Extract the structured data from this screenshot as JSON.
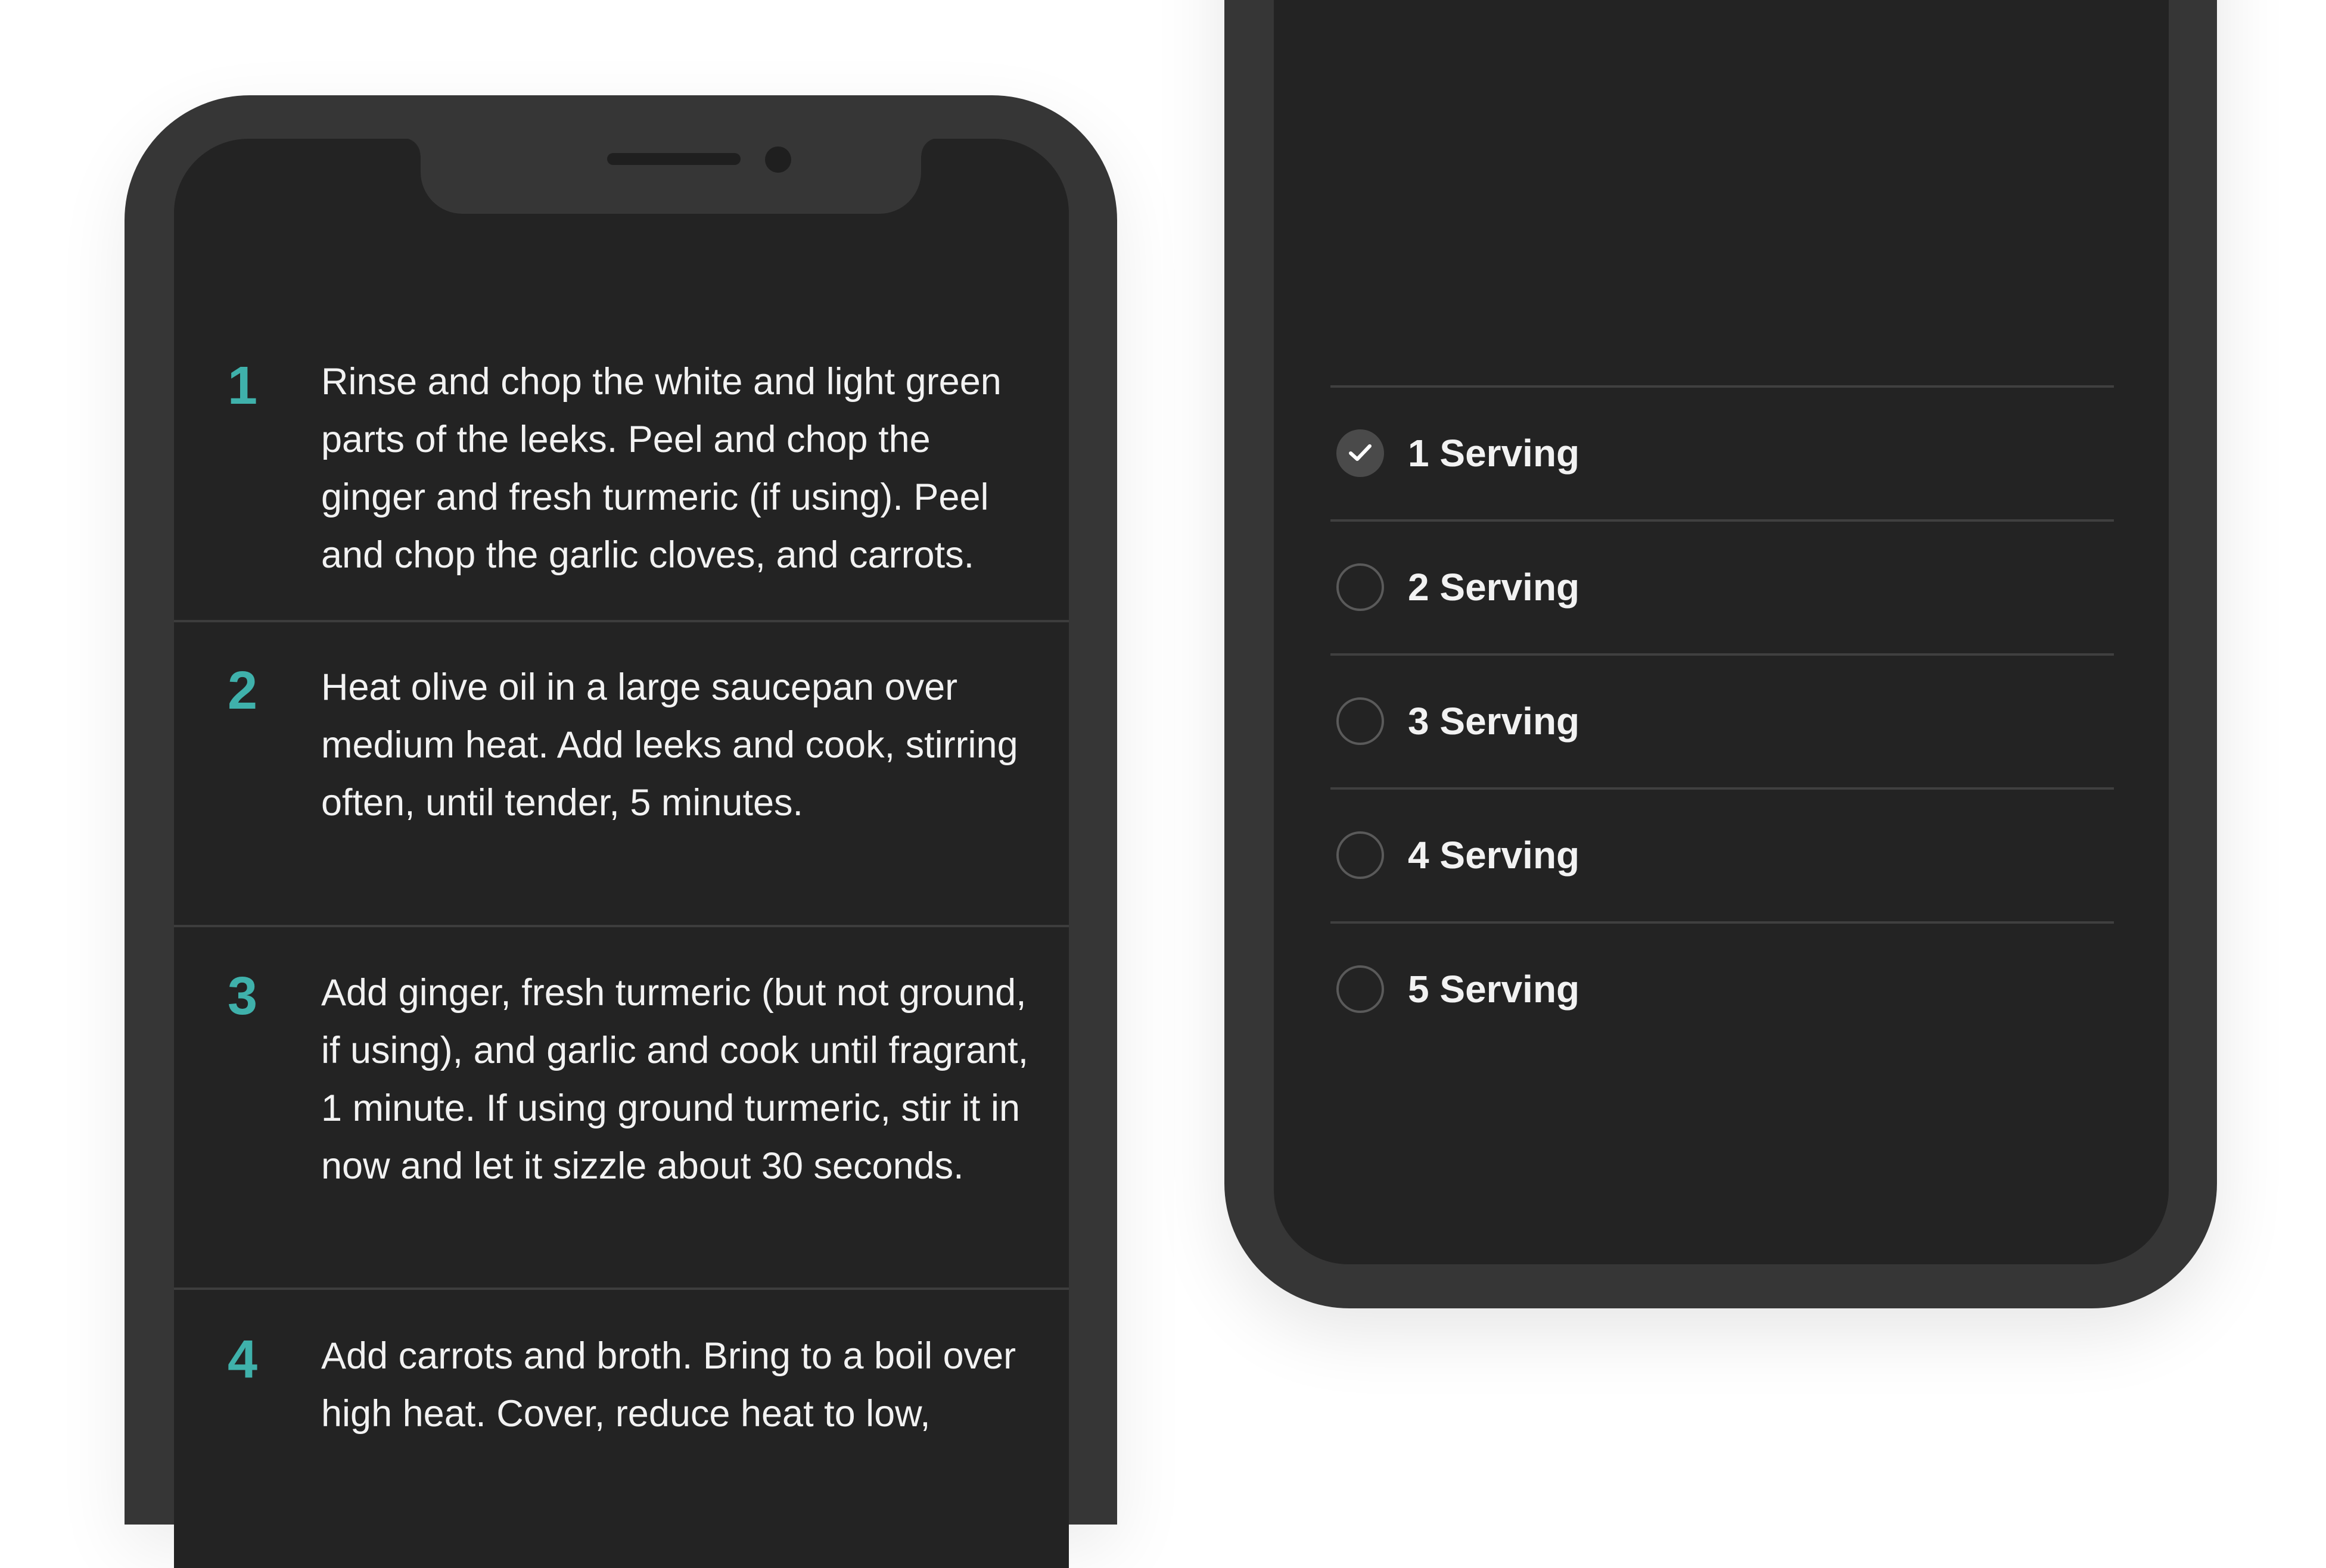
{
  "steps": [
    {
      "number": "1",
      "text": "Rinse and chop the white and light green parts of the leeks. Peel and chop the ginger and fresh turmeric (if using). Peel and chop the garlic cloves, and carrots."
    },
    {
      "number": "2",
      "text": "Heat olive oil in a large saucepan over medium heat. Add leeks and cook, stirring often, until tender, 5 minutes."
    },
    {
      "number": "3",
      "text": "Add ginger, fresh turmeric (but not ground, if using), and garlic and cook until fragrant, 1 minute. If using ground turmeric, stir it in now and let it sizzle about 30 seconds."
    },
    {
      "number": "4",
      "text": "Add carrots and broth. Bring to a boil over high heat. Cover, reduce heat to low,"
    }
  ],
  "servings": [
    {
      "label": "1 Serving",
      "selected": true
    },
    {
      "label": "2 Serving",
      "selected": false
    },
    {
      "label": "3 Serving",
      "selected": false
    },
    {
      "label": "4 Serving",
      "selected": false
    },
    {
      "label": "5 Serving",
      "selected": false
    }
  ],
  "colors": {
    "accent": "#3fb1ab",
    "screen": "#232323",
    "frame": "#363636",
    "text": "#f2f2f2"
  },
  "icons": {
    "check": "check-icon",
    "radio": "radio-empty-icon"
  }
}
